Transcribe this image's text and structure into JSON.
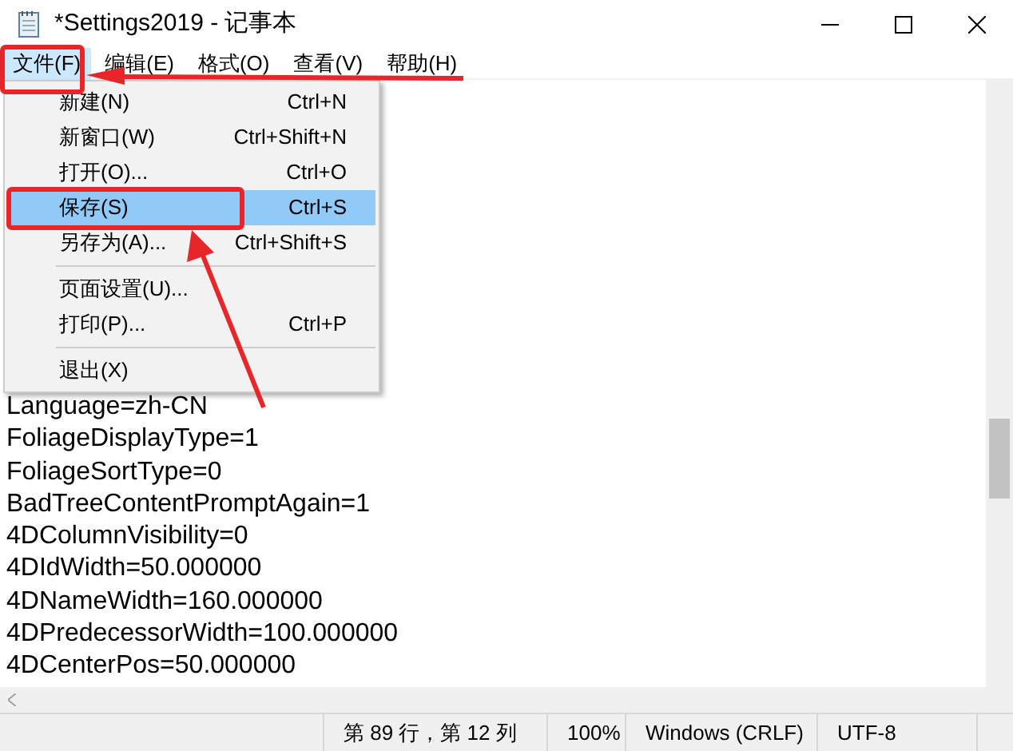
{
  "window": {
    "title": "*Settings2019 - 记事本"
  },
  "menu_bar": [
    {
      "label": "文件(F)",
      "selected": true
    },
    {
      "label": "编辑(E)",
      "selected": false
    },
    {
      "label": "格式(O)",
      "selected": false
    },
    {
      "label": "查看(V)",
      "selected": false
    },
    {
      "label": "帮助(H)",
      "selected": false
    }
  ],
  "file_menu": [
    {
      "kind": "item",
      "label": "新建(N)",
      "shortcut": "Ctrl+N",
      "selected": false
    },
    {
      "kind": "item",
      "label": "新窗口(W)",
      "shortcut": "Ctrl+Shift+N",
      "selected": false
    },
    {
      "kind": "item",
      "label": "打开(O)...",
      "shortcut": "Ctrl+O",
      "selected": false
    },
    {
      "kind": "item",
      "label": "保存(S)",
      "shortcut": "Ctrl+S",
      "selected": true
    },
    {
      "kind": "item",
      "label": "另存为(A)...",
      "shortcut": "Ctrl+Shift+S",
      "selected": false
    },
    {
      "kind": "separator"
    },
    {
      "kind": "item",
      "label": "页面设置(U)...",
      "selected": false
    },
    {
      "kind": "item",
      "label": "打印(P)...",
      "shortcut": "Ctrl+P",
      "selected": false
    },
    {
      "kind": "separator"
    },
    {
      "kind": "item",
      "label": "退出(X)",
      "selected": false
    }
  ],
  "document": {
    "lines": [
      "Language=zh-CN",
      "FoliageDisplayType=1",
      "FoliageSortType=0",
      "BadTreeContentPromptAgain=1",
      "4DColumnVisibility=0",
      "4DIdWidth=50.000000",
      "4DNameWidth=160.000000",
      "4DPredecessorWidth=100.000000",
      "4DCenterPos=50.000000"
    ]
  },
  "status_bar": {
    "position": "第 89 行，第 12 列",
    "zoom": "100%",
    "line_ending": "Windows (CRLF)",
    "encoding": "UTF-8"
  }
}
